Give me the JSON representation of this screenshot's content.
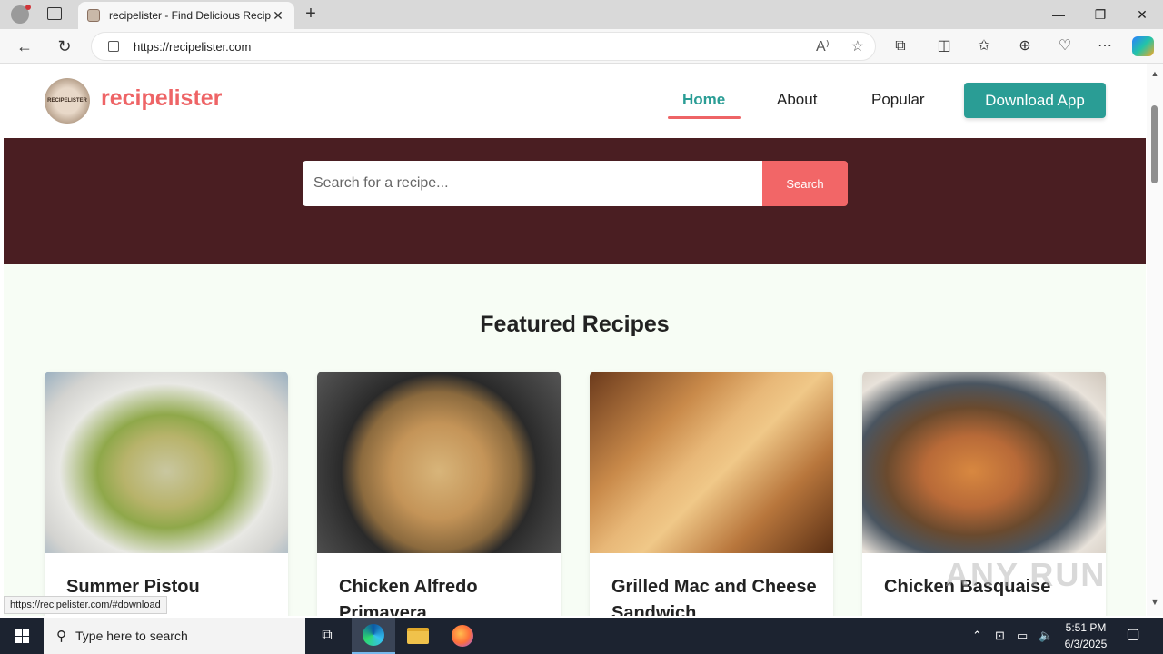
{
  "browser": {
    "tab_title": "recipelister - Find Delicious Recipes",
    "tab_close": "✕",
    "new_tab": "+",
    "url": "https://recipelister.com",
    "window_minimize": "—",
    "window_restore": "❐",
    "window_close": "✕",
    "status_url": "https://recipelister.com/#download"
  },
  "site": {
    "logo_text": "recipelister",
    "logo_badge": "RECIPELISTER",
    "nav": {
      "home": "Home",
      "about": "About",
      "popular": "Popular",
      "download": "Download App"
    },
    "search": {
      "placeholder": "Search for a recipe...",
      "button": "Search"
    },
    "featured_title": "Featured Recipes",
    "recipes": [
      {
        "title": "Summer Pistou"
      },
      {
        "title": "Chicken Alfredo Primavera"
      },
      {
        "title": "Grilled Mac and Cheese Sandwich"
      },
      {
        "title": "Chicken Basquaise"
      }
    ]
  },
  "watermark": "ANY RUN",
  "taskbar": {
    "search_placeholder": "Type here to search",
    "time": "5:51 PM",
    "date": "6/3/2025"
  },
  "colors": {
    "brand_coral": "#ee6466",
    "brand_teal": "#2a9d95",
    "hero_bg": "#4a1e22",
    "featured_bg": "#f7fdf5"
  }
}
